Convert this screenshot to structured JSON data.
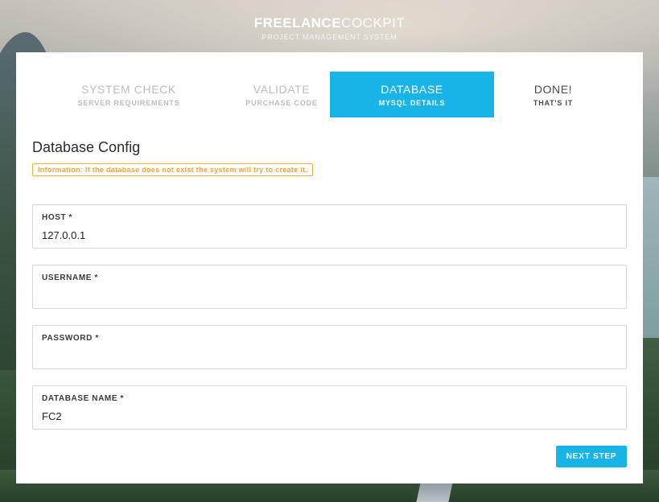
{
  "brand": {
    "title_bold": "FREELANCE",
    "title_light": "COCKPIT",
    "subtitle": "PROJECT MANAGEMENT SYSTEM"
  },
  "steps": [
    {
      "title": "SYSTEM CHECK",
      "subtitle": "SERVER REQUIREMENTS",
      "active": false
    },
    {
      "title": "VALIDATE",
      "subtitle": "PURCHASE CODE",
      "active": false
    },
    {
      "title": "DATABASE",
      "subtitle": "MYSQL DETAILS",
      "active": true
    },
    {
      "title": "DONE!",
      "subtitle": "THAT'S IT",
      "active": false
    }
  ],
  "section_title": "Database Config",
  "info_message": "Information: If the database does not exist the system will try to create it.",
  "fields": [
    {
      "label": "HOST *",
      "value": "127.0.0.1"
    },
    {
      "label": "USERNAME *",
      "value": ""
    },
    {
      "label": "PASSWORD *",
      "value": ""
    },
    {
      "label": "DATABASE NAME *",
      "value": "FC2"
    }
  ],
  "next_button_label": "NEXT STEP",
  "colors": {
    "accent": "#17b5e7",
    "info": "#f0a63a",
    "inactive_step": "#bdbdbd"
  }
}
